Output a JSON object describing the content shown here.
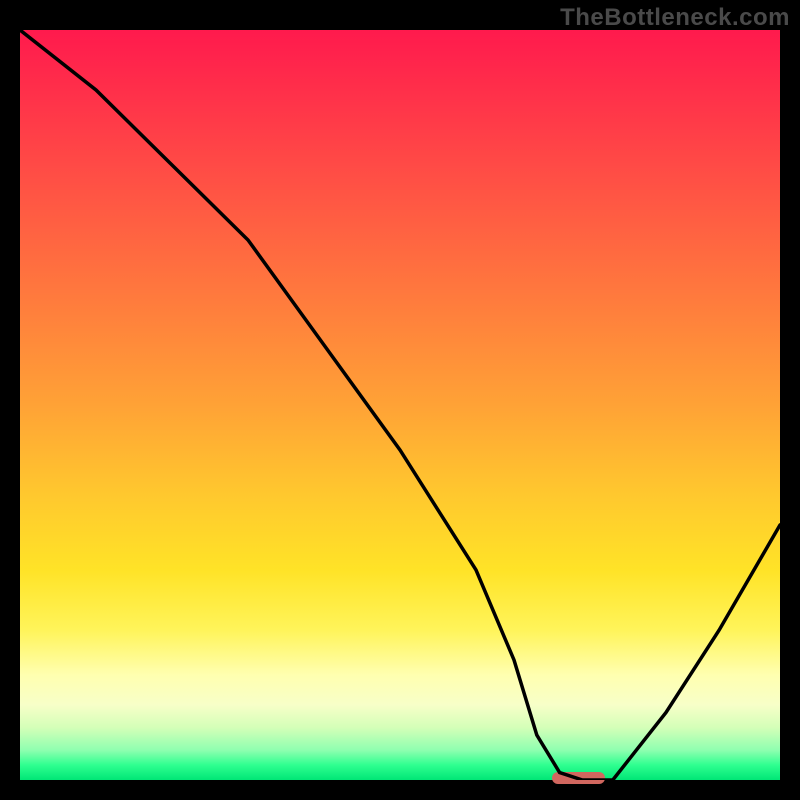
{
  "watermark": "TheBottleneck.com",
  "colors": {
    "background": "#000000",
    "watermark_text": "#4a4a4a",
    "curve_stroke": "#000000",
    "marker_fill": "#d1675f",
    "gradient_stops": [
      "#ff1a4d",
      "#ff2f4a",
      "#ff5544",
      "#ff7b3d",
      "#ffa236",
      "#ffc82e",
      "#ffe327",
      "#fff45a",
      "#ffffb0",
      "#f7ffc8",
      "#d4ffb8",
      "#8fffb0",
      "#2fff90",
      "#00e676"
    ]
  },
  "chart_data": {
    "type": "line",
    "title": "",
    "xlabel": "",
    "ylabel": "",
    "xlim": [
      0,
      100
    ],
    "ylim": [
      0,
      100
    ],
    "notes": "Bottleneck-style curve. Y axis roughly = bottleneck % (0 at bottom, 100 at top). Gradient encodes severity: green = balanced, red = heavy bottleneck.",
    "series": [
      {
        "name": "bottleneck-curve",
        "x": [
          0,
          10,
          22,
          30,
          40,
          50,
          60,
          65,
          68,
          71,
          74,
          78,
          85,
          92,
          100
        ],
        "y": [
          100,
          92,
          80,
          72,
          58,
          44,
          28,
          16,
          6,
          1,
          0,
          0,
          9,
          20,
          34
        ]
      }
    ],
    "optimal_marker": {
      "x_start": 70,
      "x_end": 77,
      "y": 0
    }
  }
}
